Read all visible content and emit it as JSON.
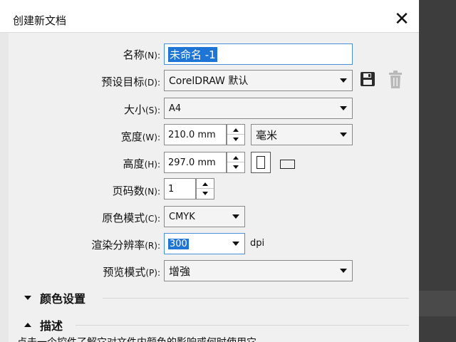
{
  "dialog": {
    "title": "创建新文档",
    "close_label": "✕"
  },
  "form": {
    "name": {
      "label": "名称",
      "accel": "(N):",
      "value": "未命名 -1"
    },
    "preset": {
      "label": "预设目标",
      "accel": "(D):",
      "value": "CorelDRAW 默认"
    },
    "size": {
      "label": "大小",
      "accel": "(S):",
      "value": "A4"
    },
    "width": {
      "label": "宽度",
      "accel": "(W):",
      "value": "210.0 mm",
      "unit": "毫米"
    },
    "height": {
      "label": "高度",
      "accel": "(H):",
      "value": "297.0 mm"
    },
    "pages": {
      "label": "页码数",
      "accel": "(N):",
      "value": "1"
    },
    "color_mode": {
      "label": "原色模式",
      "accel": "(C):",
      "value": "CMYK"
    },
    "resolution": {
      "label": "渲染分辨率",
      "accel": "(R):",
      "value": "300",
      "unit": "dpi"
    },
    "preview": {
      "label": "预览模式",
      "accel": "(P):",
      "value": "增強"
    }
  },
  "sections": {
    "color_settings": "颜色设置",
    "description": "描述"
  },
  "description_text": "点击一个控件了解它对文件内颜色的影响或何时使用它。",
  "icons": {
    "save": "save-preset-icon",
    "delete": "delete-preset-icon",
    "portrait": "portrait-orientation-icon",
    "landscape": "landscape-orientation-icon"
  },
  "colors": {
    "accent": "#1e75d6",
    "focus_border": "#4a90d9"
  }
}
